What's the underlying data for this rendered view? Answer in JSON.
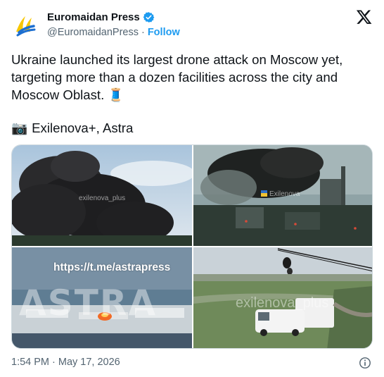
{
  "author": {
    "display_name": "Euromaidan Press",
    "handle": "@EuromaidanPress",
    "separator": "·",
    "follow_label": "Follow"
  },
  "tweet": {
    "text": "Ukraine launched its largest drone attack on Moscow yet, targeting more than a dozen facilities across the city and Moscow Oblast. 🧵",
    "credit_icon": "📷",
    "credit_text": "Exilenova+, Astra"
  },
  "media": {
    "tile1_watermark": "exilenova_plus",
    "tile2_watermark": "Exilenova",
    "tile3_url": "https://t.me/astrapress",
    "tile3_word": "ASTRA",
    "tile4_watermark": "exilenova_plus"
  },
  "footer": {
    "timestamp": "1:54 PM · May 17, 2026"
  },
  "colors": {
    "accent": "#1d9bf0",
    "text": "#0f1419",
    "secondary": "#536471"
  }
}
